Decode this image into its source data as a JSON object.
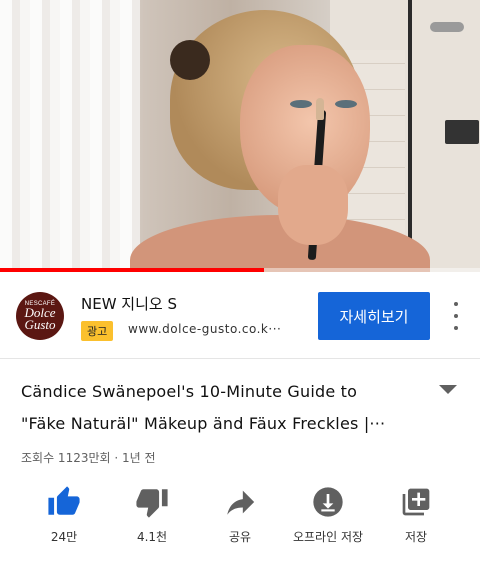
{
  "video": {
    "progress_fraction": 0.55
  },
  "ad": {
    "logo_lines": [
      "NESCAFÉ",
      "Dolce",
      "Gusto"
    ],
    "title": "NEW 지니오 S",
    "badge": "광고",
    "url": "www.dolce-gusto.co.k···",
    "cta": "자세히보기",
    "more_icon": "more-vert-icon"
  },
  "video_info": {
    "title_lines": [
      "Cändice Swänepoel's 10-Minute Guide to",
      "\"Fäke Naturäl\" Mäkeup änd Fäux Freckles |···"
    ],
    "meta": "조회수 1123만회 · 1년 전",
    "expand_icon": "chevron-down-icon"
  },
  "actions": [
    {
      "icon": "thumb-up-icon",
      "label": "24만"
    },
    {
      "icon": "thumb-down-icon",
      "label": "4.1천"
    },
    {
      "icon": "share-icon",
      "label": "공유"
    },
    {
      "icon": "download-icon",
      "label": "오프라인 저장"
    },
    {
      "icon": "playlist-add-icon",
      "label": "저장"
    }
  ],
  "colors": {
    "accent": "#ff0000",
    "cta": "#1565d8",
    "badge": "#fbc02d",
    "like_active": "#1565d8"
  }
}
